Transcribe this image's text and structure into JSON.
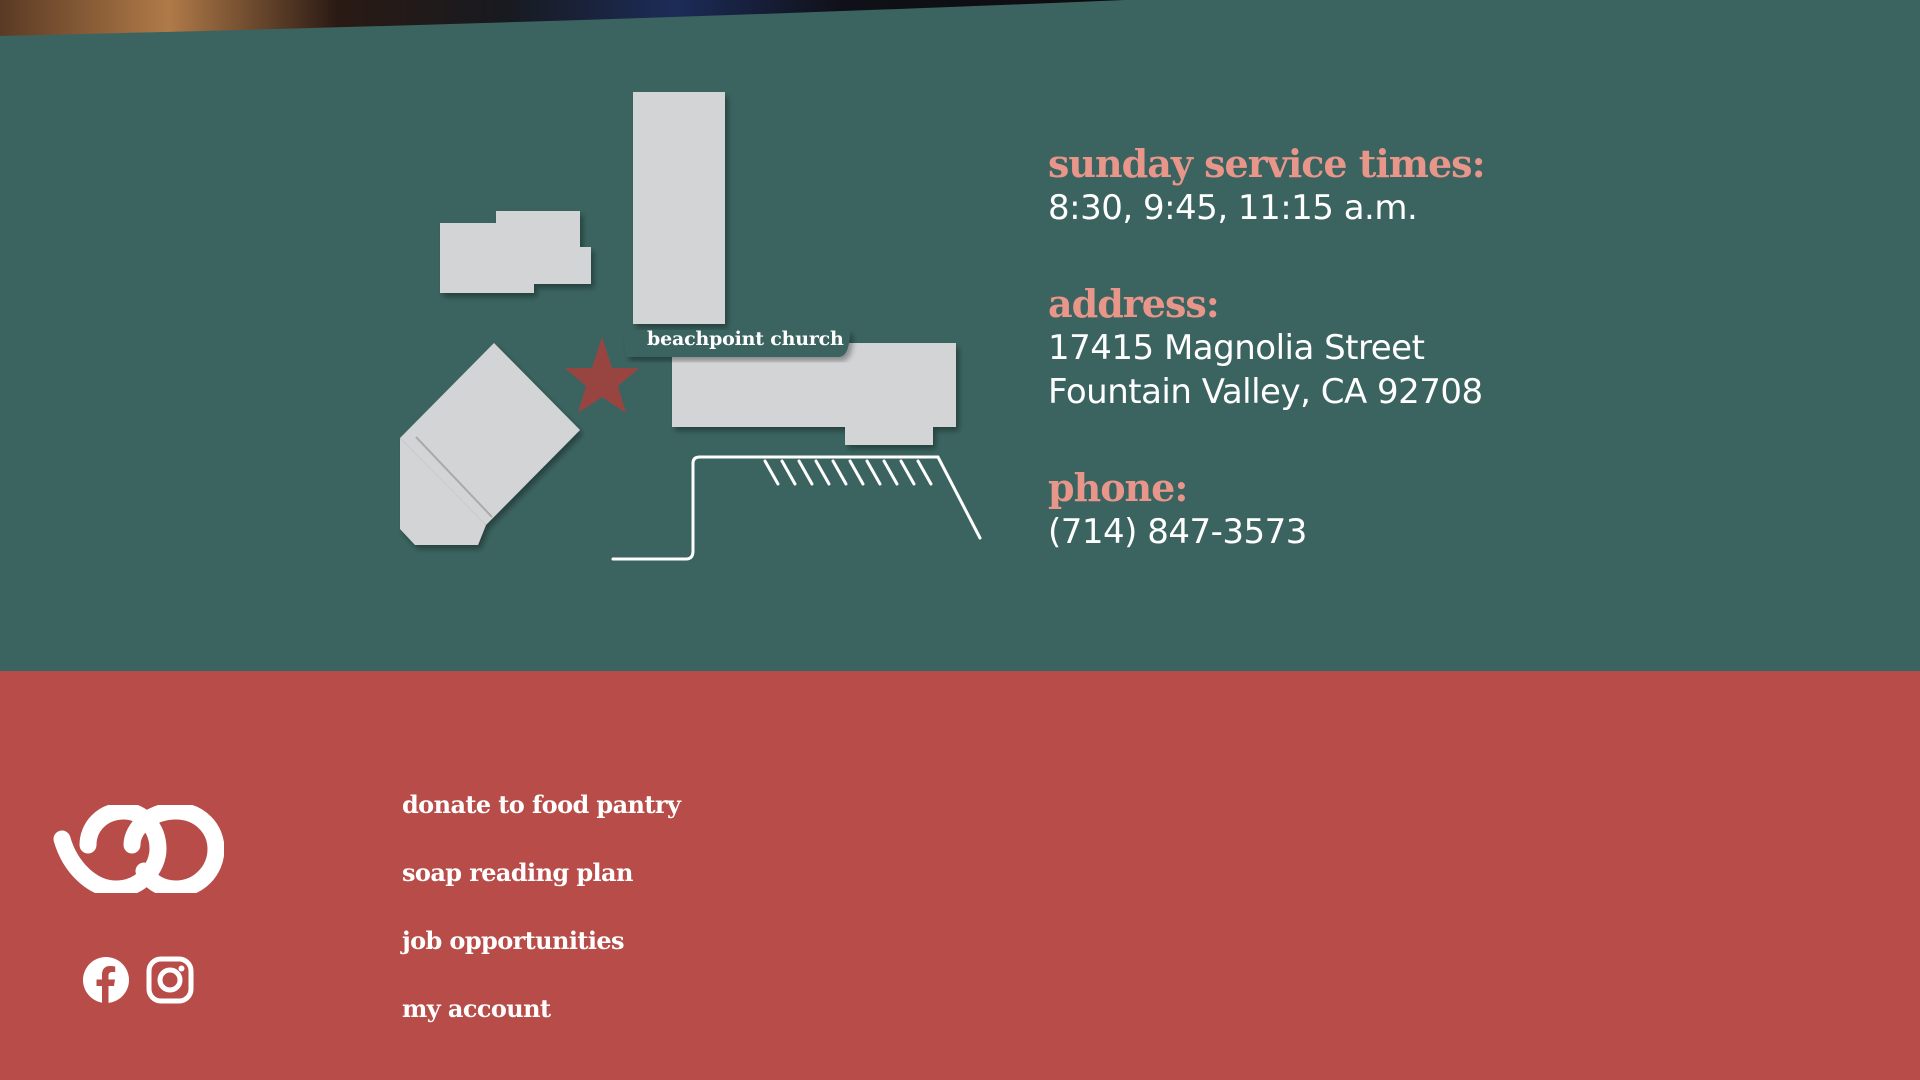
{
  "map": {
    "label": "beachpoint church"
  },
  "info": {
    "service_heading": "sunday service times:",
    "service_times": "8:30, 9:45, 11:15 a.m.",
    "address_heading": "address:",
    "address_line1": "17415 Magnolia Street",
    "address_line2": "Fountain Valley, CA 92708",
    "phone_heading": "phone:",
    "phone": "(714) 847-3573"
  },
  "footer": {
    "links": [
      "donate to food pantry",
      "soap reading plan",
      "job opportunities",
      "my account"
    ],
    "icons": [
      "facebook-icon",
      "instagram-icon"
    ]
  },
  "colors": {
    "section_bg": "#3b6460",
    "footer_bg": "#b84c48",
    "heading_accent": "#e8958a",
    "building": "#d3d4d6",
    "marker_star": "#a3413f"
  }
}
